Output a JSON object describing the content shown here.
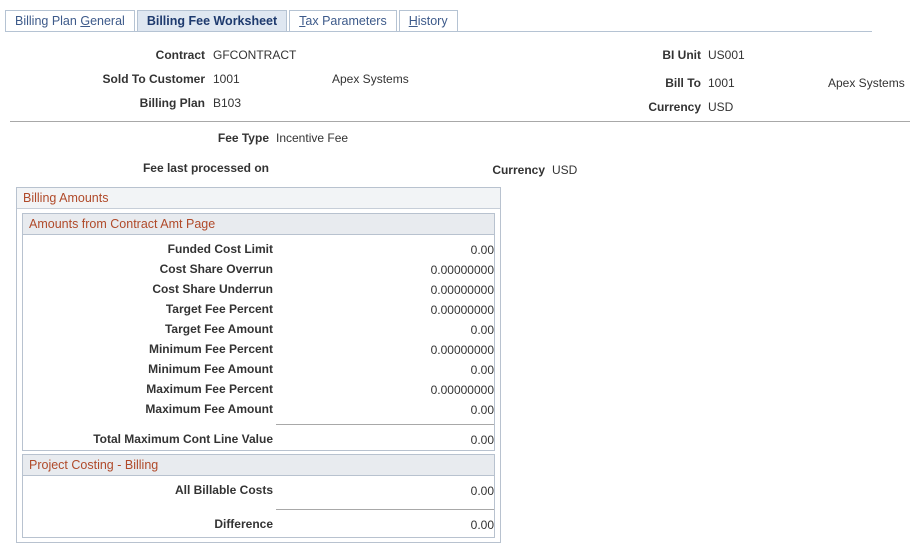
{
  "tabs": [
    {
      "label": "Billing Plan ",
      "ul": "G",
      "rest": "eneral"
    },
    {
      "label": "Billing Fee Worksheet"
    },
    {
      "label": "",
      "ul": "T",
      "rest": "ax Parameters"
    },
    {
      "label": "",
      "ul": "H",
      "rest": "istory"
    }
  ],
  "header": {
    "contract_label": "Contract",
    "contract": "GFCONTRACT",
    "sold_to_label": "Sold To Customer",
    "sold_to_id": "1001",
    "sold_to_name": "Apex Systems",
    "billing_plan_label": "Billing Plan",
    "billing_plan": "B103",
    "bi_unit_label": "BI Unit",
    "bi_unit": "US001",
    "bill_to_label": "Bill To",
    "bill_to_id": "1001",
    "bill_to_name": "Apex Systems",
    "currency_label": "Currency",
    "currency": "USD"
  },
  "fee": {
    "fee_type_label": "Fee Type",
    "fee_type": "Incentive Fee",
    "last_processed_label": "Fee last processed on",
    "currency_label": "Currency",
    "currency": "USD"
  },
  "billing_amounts": {
    "title": "Billing Amounts",
    "contract_section": {
      "title": "Amounts from Contract Amt Page",
      "rows": [
        {
          "label": "Funded Cost Limit",
          "value": "0.00"
        },
        {
          "label": "Cost Share Overrun",
          "value": "0.00000000"
        },
        {
          "label": "Cost Share Underrun",
          "value": "0.00000000"
        },
        {
          "label": "Target Fee Percent",
          "value": "0.00000000"
        },
        {
          "label": "Target Fee Amount",
          "value": "0.00"
        },
        {
          "label": "Minimum Fee Percent",
          "value": "0.00000000"
        },
        {
          "label": "Minimum Fee Amount",
          "value": "0.00"
        },
        {
          "label": "Maximum Fee Percent",
          "value": "0.00000000"
        },
        {
          "label": "Maximum Fee Amount",
          "value": "0.00"
        }
      ],
      "total_label": "Total Maximum Cont Line Value",
      "total_value": "0.00"
    },
    "project_section": {
      "title": "Project Costing - Billing",
      "all_billable_label": "All Billable Costs",
      "all_billable_value": "0.00",
      "difference_label": "Difference",
      "difference_value": "0.00"
    }
  }
}
